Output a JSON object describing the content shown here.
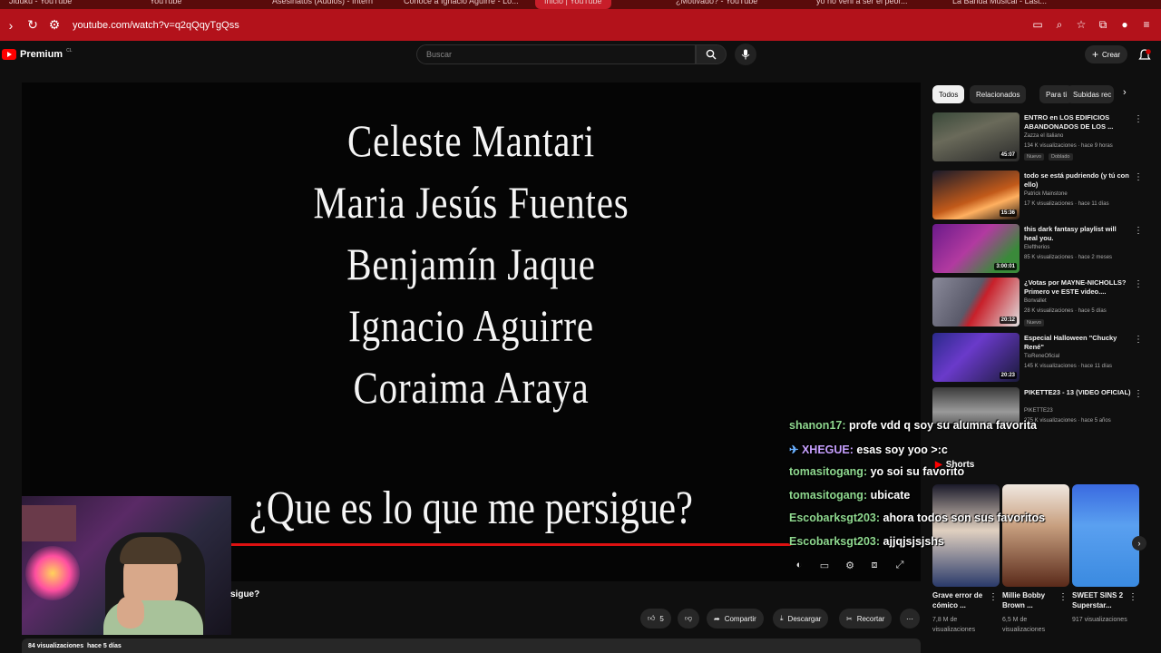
{
  "browser": {
    "tabs": [
      "Jiduku - YouTube",
      "YouTube",
      "Asesinatos (Audios) - Intern",
      "Conoce a Ignacio Aguirre - Lo...",
      "Inicio | YouTube",
      "¿Motivado? - YouTube",
      "yo no veni a ser el peor...",
      "La Banda Musical - Last..."
    ],
    "url": "youtube.com/watch?v=q2qQqyTgQss"
  },
  "header": {
    "logo_text": "Premium",
    "logo_sup": "CL",
    "search_placeholder": "Buscar",
    "create_label": "Crear"
  },
  "video": {
    "credits": [
      "Celeste Mantari",
      "Maria Jesús Fuentes",
      "Benjamín Jaque",
      "Ignacio Aguirre",
      "Coraima Araya"
    ],
    "question": "¿Que es lo que me persigue?",
    "progress": 1.0,
    "title_fragment": "sigue?"
  },
  "actions": {
    "like_count": "5",
    "share": "Compartir",
    "download": "Descargar",
    "clip": "Recortar"
  },
  "meta": {
    "views": "84 visualizaciones",
    "date": "hace 5 días"
  },
  "sidebar": {
    "chips": [
      "Todos",
      "Relacionados",
      "Para ti",
      "Subidas rec"
    ],
    "recommendations": [
      {
        "title": "ENTRO en LOS EDIFICIOS ABANDONADOS DE LOS ...",
        "channel": "Zazza el italiano",
        "meta": "134 K visualizaciones · hace 9 horas",
        "duration": "45:07",
        "badge": "Nuevo",
        "badge2": "Doblado"
      },
      {
        "title": "todo se está pudriendo (y tú con ello)",
        "channel": "Patrick Mainstone",
        "meta": "17 K visualizaciones · hace 11 días",
        "duration": "15:36",
        "badge": "",
        "badge2": ""
      },
      {
        "title": "this dark fantasy playlist will heal you.",
        "channel": "Eleftherios",
        "meta": "85 K visualizaciones · hace 2 meses",
        "duration": "3:00:01",
        "badge": "",
        "badge2": ""
      },
      {
        "title": "¿Votas por MAYNE-NICHOLLS? Primero ve ESTE video....",
        "channel": "Bonvallet",
        "meta": "28 K visualizaciones · hace 5 días",
        "duration": "20:12",
        "badge": "Nuevo",
        "badge2": ""
      },
      {
        "title": "Especial Halloween \"Chucky René\"",
        "channel": "TioReneOficial",
        "meta": "145 K visualizaciones · hace 11 días",
        "duration": "20:23",
        "badge": "",
        "badge2": ""
      },
      {
        "title": "PIKETTE23 - 13 (VIDEO OFICIAL)",
        "channel": "PIKETTE23",
        "meta": "275 K visualizaciones · hace 5 años",
        "duration": "",
        "badge": "",
        "badge2": ""
      }
    ],
    "shorts_label": "Shorts",
    "shorts": [
      {
        "title": "Grave error de cómico ...",
        "views": "7,8 M de visualizaciones"
      },
      {
        "title": "Millie Bobby Brown ...",
        "views": "6,5 M de visualizaciones"
      },
      {
        "title": "SWEET SINS 2 Superstar...",
        "views": "917 visualizaciones"
      }
    ]
  },
  "chat": [
    {
      "user": "shanon17:",
      "msg": "profe vdd q soy su alumna favorita"
    },
    {
      "user": "XHEGUE:",
      "msg": "esas soy yoo >:c"
    },
    {
      "user": "tomasitogang:",
      "msg": "yo soi su favorito"
    },
    {
      "user": "tomasitogang:",
      "msg": "ubicate"
    },
    {
      "user": "Escobarksgt203:",
      "msg": "ahora todos son sus favoritos"
    },
    {
      "user": "Escobarksgt203:",
      "msg": "ajjqjsjsjshs"
    }
  ],
  "colors": {
    "browser_accent": "#b3121b",
    "yt_red": "#ff0000",
    "chat_user": "#8fd88f"
  }
}
